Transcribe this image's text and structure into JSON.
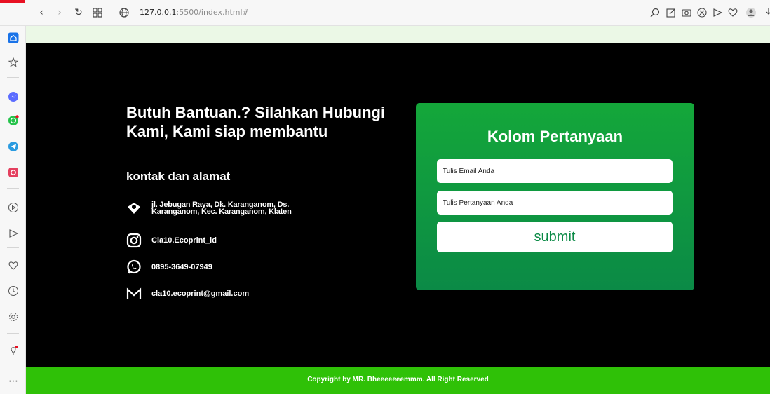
{
  "browser": {
    "url_host": "127.0.0.1",
    "url_rest": ":5500/index.html#"
  },
  "sidebar": {
    "items": [
      {
        "name": "home-icon"
      },
      {
        "name": "favorites-icon"
      },
      {
        "name": "messenger-icon"
      },
      {
        "name": "whatsapp-icon"
      },
      {
        "name": "telegram-icon"
      },
      {
        "name": "instagram-icon"
      },
      {
        "name": "player-icon"
      },
      {
        "name": "flow-icon"
      },
      {
        "name": "heart-icon"
      },
      {
        "name": "history-icon"
      },
      {
        "name": "settings-icon"
      },
      {
        "name": "tips-icon"
      },
      {
        "name": "more-icon"
      }
    ]
  },
  "hero": {
    "headline": "Butuh Bantuan.? Silahkan Hubungi Kami, Kami siap membantu",
    "subhead": "kontak dan alamat"
  },
  "contacts": {
    "address": "jl. Jebugan Raya, Dk. Karanganom, Ds. Karanganom, Kec. Karanganom, Klaten",
    "instagram": "Cla10.Ecoprint_id",
    "phone": "0895-3649-07949",
    "email": "cla10.ecoprint@gmail.com"
  },
  "form": {
    "title": "Kolom Pertanyaan",
    "email_placeholder": "Tulis Email Anda",
    "question_placeholder": "Tulis Pertanyaan Anda",
    "submit_label": "submit"
  },
  "footer": {
    "copyright": "Copyright by MR. Bheeeeeeemmm. All Right Reserved"
  },
  "colors": {
    "accent_green": "#2fc107",
    "card_green": "#0b8a46"
  }
}
